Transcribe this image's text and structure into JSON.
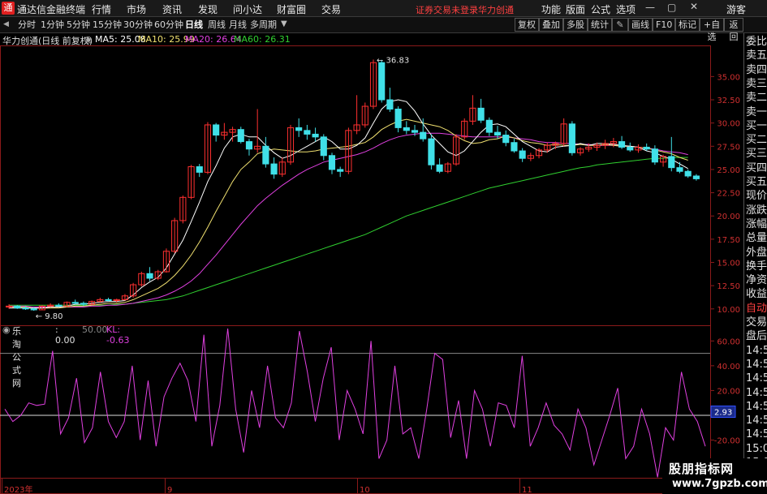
{
  "titlebar": {
    "app_title": "通达信金融终端",
    "menus": [
      "行情",
      "市场",
      "资讯",
      "发现",
      "问小达",
      "财富圈",
      "交易"
    ],
    "login_status": "证券交易未登录",
    "stock_title": "华力创通",
    "right_menus": [
      "功能",
      "版面",
      "公式",
      "选项"
    ],
    "guest": "游客"
  },
  "toolbar": {
    "periods": [
      "分时",
      "1分钟",
      "5分钟",
      "15分钟",
      "30分钟",
      "60分钟",
      "日线",
      "周线",
      "月线",
      "多周期"
    ],
    "active_period": "日线",
    "buttons": [
      "复权",
      "叠加",
      "多股",
      "统计",
      "画线",
      "F10",
      "标记",
      "+自选",
      "返回"
    ]
  },
  "infoline": {
    "stock_label": "华力创通(日线 前复权)",
    "ma5": "MA5: 25.08",
    "ma10": "MA10: 25.99",
    "ma20": "MA20: 26.64",
    "ma60": "MA60: 26.31"
  },
  "colors": {
    "up": "#ff3030",
    "down": "#40e0e8",
    "ma5": "#ffffff",
    "ma10": "#f0e070",
    "ma20": "#e040e0",
    "ma60": "#30d030",
    "indicator": "#e040e0"
  },
  "price_axis": {
    "ticks": [
      "35.00",
      "32.50",
      "30.00",
      "27.50",
      "25.00",
      "22.50",
      "20.00",
      "17.50",
      "15.00",
      "12.50",
      "10.00"
    ],
    "high_label": "36.83",
    "low_label": "9.80"
  },
  "indicator": {
    "label": "乐淘公式网",
    "value_main": ": 0.00",
    "value_line": "50.00",
    "kl_label": "KL: -0.63",
    "ticks": [
      "60.00",
      "40.00",
      "20.00",
      "-20.00",
      "-40.00"
    ],
    "current": "2.93"
  },
  "time_axis": [
    "2023年",
    "9",
    "10",
    "11"
  ],
  "side_panel": [
    "委比",
    "卖五",
    "卖四",
    "卖三",
    "卖二",
    "卖一",
    "买一",
    "买二",
    "买三",
    "买四",
    "买五",
    "现价",
    "涨跌",
    "涨幅",
    "总量",
    "外盘",
    "换手",
    "净资",
    "收益",
    "自动",
    "交易",
    "盘后",
    "14:56",
    "14:56",
    "14:56",
    "14:56",
    "14:56",
    "14:57",
    "14:58",
    "15:00",
    "15:00"
  ],
  "watermark": {
    "cn": "股朋指标网",
    "en": "www.7gpzb.com"
  },
  "chart_data": {
    "type": "line",
    "title": "华力创通(日线 前复权)",
    "ylim": [
      8.5,
      38
    ],
    "candles": [
      [
        10.2,
        10.5,
        10.0,
        10.3
      ],
      [
        10.3,
        10.4,
        10.0,
        10.1
      ],
      [
        10.1,
        10.3,
        9.9,
        10.0
      ],
      [
        10.0,
        10.2,
        9.8,
        9.9
      ],
      [
        9.9,
        10.4,
        9.9,
        10.3
      ],
      [
        10.3,
        10.6,
        10.2,
        10.4
      ],
      [
        10.4,
        10.6,
        10.2,
        10.3
      ],
      [
        10.3,
        10.8,
        10.2,
        10.7
      ],
      [
        10.7,
        11.0,
        10.5,
        10.6
      ],
      [
        10.6,
        10.8,
        10.3,
        10.5
      ],
      [
        10.5,
        10.9,
        10.4,
        10.8
      ],
      [
        10.8,
        11.2,
        10.7,
        11.0
      ],
      [
        11.0,
        11.2,
        10.8,
        10.9
      ],
      [
        10.9,
        11.1,
        10.7,
        11.0
      ],
      [
        11.0,
        11.6,
        10.9,
        11.4
      ],
      [
        11.4,
        12.8,
        11.2,
        12.6
      ],
      [
        12.6,
        14.0,
        12.4,
        13.8
      ],
      [
        13.8,
        14.5,
        13.0,
        13.3
      ],
      [
        13.3,
        14.2,
        13.1,
        14.0
      ],
      [
        14.0,
        16.5,
        13.9,
        16.2
      ],
      [
        16.2,
        19.8,
        16.0,
        19.5
      ],
      [
        19.5,
        22.2,
        19.2,
        22.0
      ],
      [
        22.0,
        25.5,
        21.8,
        25.3
      ],
      [
        25.3,
        25.6,
        24.2,
        24.7
      ],
      [
        24.7,
        30.1,
        24.5,
        29.8
      ],
      [
        29.8,
        30.0,
        28.0,
        28.7
      ],
      [
        28.7,
        30.0,
        28.2,
        29.0
      ],
      [
        29.0,
        29.6,
        28.0,
        29.3
      ],
      [
        29.3,
        29.6,
        27.8,
        28.0
      ],
      [
        28.0,
        28.3,
        26.5,
        27.2
      ],
      [
        27.2,
        31.5,
        26.8,
        27.5
      ],
      [
        27.5,
        28.5,
        25.2,
        25.6
      ],
      [
        25.6,
        26.3,
        24.0,
        24.5
      ],
      [
        24.5,
        26.3,
        24.2,
        25.8
      ],
      [
        25.8,
        29.8,
        25.5,
        29.5
      ],
      [
        29.5,
        30.5,
        28.5,
        29.2
      ],
      [
        29.2,
        29.8,
        28.2,
        28.8
      ],
      [
        28.8,
        29.5,
        28.0,
        28.5
      ],
      [
        28.5,
        28.8,
        26.0,
        26.5
      ],
      [
        26.5,
        26.8,
        24.5,
        25.0
      ],
      [
        25.0,
        25.3,
        24.2,
        24.8
      ],
      [
        24.8,
        29.5,
        24.5,
        29.2
      ],
      [
        29.2,
        33.0,
        28.8,
        29.8
      ],
      [
        29.8,
        32.2,
        29.5,
        31.8
      ],
      [
        31.8,
        36.83,
        31.5,
        36.5
      ],
      [
        36.5,
        36.8,
        32.2,
        32.5
      ],
      [
        32.5,
        33.8,
        31.2,
        31.5
      ],
      [
        31.5,
        31.8,
        29.0,
        29.5
      ],
      [
        29.5,
        30.2,
        28.8,
        29.2
      ],
      [
        29.2,
        29.8,
        28.6,
        29.0
      ],
      [
        29.0,
        30.5,
        28.0,
        28.3
      ],
      [
        28.3,
        28.8,
        25.0,
        25.5
      ],
      [
        25.5,
        26.2,
        24.6,
        24.8
      ],
      [
        24.8,
        25.8,
        24.6,
        25.6
      ],
      [
        25.6,
        28.8,
        25.4,
        28.5
      ],
      [
        28.5,
        30.5,
        28.2,
        30.2
      ],
      [
        30.2,
        33.0,
        29.8,
        31.6
      ],
      [
        31.6,
        32.6,
        30.0,
        30.3
      ],
      [
        30.3,
        30.6,
        28.6,
        29.0
      ],
      [
        29.0,
        29.7,
        28.3,
        28.7
      ],
      [
        28.7,
        29.2,
        27.5,
        27.9
      ],
      [
        27.9,
        28.3,
        26.8,
        27.0
      ],
      [
        27.0,
        27.3,
        25.8,
        26.2
      ],
      [
        26.2,
        26.8,
        25.9,
        26.5
      ],
      [
        26.5,
        27.3,
        26.2,
        27.1
      ],
      [
        27.1,
        27.9,
        26.8,
        27.6
      ],
      [
        27.6,
        28.0,
        27.2,
        27.8
      ],
      [
        27.8,
        30.5,
        27.5,
        29.9
      ],
      [
        29.9,
        30.2,
        26.5,
        26.8
      ],
      [
        26.8,
        27.4,
        26.5,
        27.2
      ],
      [
        27.2,
        27.8,
        26.9,
        27.4
      ],
      [
        27.4,
        27.9,
        27.0,
        27.6
      ],
      [
        27.6,
        28.2,
        27.2,
        27.8
      ],
      [
        27.8,
        28.4,
        27.4,
        28.0
      ],
      [
        28.0,
        28.6,
        27.2,
        27.4
      ],
      [
        27.4,
        27.9,
        26.9,
        27.1
      ],
      [
        27.1,
        27.7,
        26.8,
        27.4
      ],
      [
        27.4,
        27.8,
        27.0,
        27.2
      ],
      [
        27.2,
        27.6,
        25.5,
        25.8
      ],
      [
        25.8,
        26.6,
        25.3,
        26.4
      ],
      [
        26.4,
        28.5,
        24.8,
        25.2
      ],
      [
        25.2,
        25.8,
        24.6,
        24.8
      ],
      [
        24.8,
        25.0,
        24.1,
        24.3
      ],
      [
        24.3,
        24.5,
        23.8,
        24.0
      ]
    ],
    "ma5": [
      10.1,
      10.1,
      10.1,
      10.1,
      10.1,
      10.2,
      10.2,
      10.3,
      10.5,
      10.5,
      10.6,
      10.7,
      10.8,
      10.8,
      10.9,
      11.5,
      12.3,
      12.9,
      13.4,
      14.4,
      15.9,
      17.4,
      19.4,
      21.5,
      23.7,
      25.4,
      27.3,
      28.5,
      28.8,
      28.5,
      28.5,
      27.6,
      26.8,
      26.2,
      26.5,
      27.0,
      27.5,
      28.0,
      28.5,
      28.0,
      27.2,
      27.2,
      27.6,
      28.4,
      30.0,
      31.5,
      32.3,
      32.5,
      32.3,
      31.3,
      29.9,
      28.7,
      27.8,
      26.9,
      26.5,
      27.0,
      28.0,
      29.0,
      29.8,
      29.9,
      29.6,
      28.8,
      28.0,
      27.5,
      27.0,
      26.9,
      27.4,
      27.5,
      27.6,
      27.8,
      27.6,
      27.8,
      27.8,
      27.7,
      27.6,
      27.5,
      27.4,
      27.0,
      26.8,
      26.4,
      26.1,
      25.6,
      25.1
    ],
    "ma10": [
      10.2,
      10.2,
      10.2,
      10.1,
      10.1,
      10.1,
      10.1,
      10.2,
      10.3,
      10.3,
      10.4,
      10.5,
      10.6,
      10.6,
      10.7,
      11.0,
      11.4,
      11.8,
      12.2,
      12.8,
      13.6,
      14.6,
      15.8,
      17.2,
      18.8,
      20.5,
      22.1,
      23.7,
      25.0,
      25.8,
      26.7,
      27.0,
      27.2,
      27.1,
      27.0,
      26.9,
      26.9,
      27.0,
      27.2,
      27.3,
      27.4,
      27.5,
      27.7,
      27.9,
      28.5,
      29.3,
      29.8,
      30.2,
      30.4,
      30.2,
      30.0,
      29.8,
      29.6,
      29.2,
      28.6,
      28.1,
      27.8,
      27.9,
      28.2,
      28.3,
      28.6,
      28.4,
      28.1,
      27.9,
      27.8,
      27.6,
      27.7,
      27.6,
      27.6,
      27.7,
      27.6,
      27.6,
      27.7,
      27.6,
      27.5,
      27.5,
      27.4,
      27.3,
      27.1,
      26.9,
      26.7,
      26.3,
      26.0
    ],
    "ma20": [
      10.3,
      10.3,
      10.3,
      10.2,
      10.2,
      10.2,
      10.2,
      10.2,
      10.2,
      10.2,
      10.3,
      10.3,
      10.4,
      10.4,
      10.5,
      10.6,
      10.8,
      11.0,
      11.2,
      11.5,
      11.9,
      12.4,
      13.0,
      13.8,
      14.8,
      15.8,
      16.9,
      18.0,
      19.1,
      20.1,
      21.1,
      21.9,
      22.6,
      23.3,
      23.9,
      24.5,
      25.0,
      25.4,
      25.8,
      26.0,
      26.2,
      26.4,
      26.6,
      26.9,
      27.3,
      27.8,
      28.2,
      28.5,
      28.7,
      28.8,
      28.9,
      28.9,
      28.9,
      28.8,
      28.7,
      28.6,
      28.5,
      28.5,
      28.5,
      28.5,
      28.5,
      28.4,
      28.3,
      28.2,
      28.0,
      27.9,
      27.9,
      27.8,
      27.8,
      27.7,
      27.7,
      27.6,
      27.6,
      27.6,
      27.5,
      27.5,
      27.4,
      27.3,
      27.2,
      27.0,
      26.9,
      26.8,
      26.6
    ],
    "ma60": [
      10.4,
      10.4,
      10.4,
      10.4,
      10.4,
      10.4,
      10.4,
      10.4,
      10.4,
      10.4,
      10.4,
      10.4,
      10.4,
      10.5,
      10.5,
      10.6,
      10.7,
      10.8,
      10.9,
      11.0,
      11.2,
      11.4,
      11.7,
      12.0,
      12.3,
      12.6,
      12.9,
      13.2,
      13.5,
      13.8,
      14.1,
      14.4,
      14.7,
      15.0,
      15.3,
      15.6,
      15.9,
      16.2,
      16.5,
      16.8,
      17.1,
      17.4,
      17.7,
      18.0,
      18.4,
      18.8,
      19.2,
      19.6,
      20.0,
      20.3,
      20.6,
      20.9,
      21.2,
      21.5,
      21.8,
      22.1,
      22.4,
      22.7,
      23.0,
      23.2,
      23.4,
      23.6,
      23.8,
      24.0,
      24.2,
      24.4,
      24.6,
      24.8,
      25.0,
      25.2,
      25.3,
      25.5,
      25.6,
      25.7,
      25.8,
      25.9,
      26.0,
      26.1,
      26.2,
      26.2,
      26.3,
      26.3,
      26.3
    ],
    "indicator_ylim": [
      -55,
      72
    ],
    "indicator_values": [
      5,
      -5,
      0,
      10,
      8,
      9,
      52,
      -15,
      -2,
      30,
      -22,
      -10,
      35,
      -5,
      -18,
      -5,
      40,
      -20,
      28,
      -25,
      15,
      30,
      42,
      28,
      -5,
      65,
      -25,
      8,
      70,
      5,
      -30,
      20,
      -10,
      40,
      -2,
      -10,
      10,
      68,
      35,
      -5,
      30,
      55,
      -20,
      20,
      5,
      -15,
      60,
      -35,
      -20,
      40,
      -15,
      -10,
      -35,
      5,
      50,
      45,
      -18,
      12,
      -35,
      20,
      5,
      -25,
      10,
      8,
      -10,
      48,
      -25,
      -10,
      10,
      -8,
      -15,
      -28,
      5,
      -10,
      -40,
      -20,
      0,
      22,
      -35,
      -25,
      5,
      -15,
      -50,
      -10,
      -20,
      35,
      5,
      -5,
      -25
    ]
  }
}
